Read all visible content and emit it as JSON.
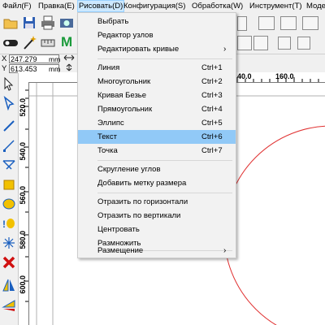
{
  "menubar": {
    "items": [
      {
        "label": "Файл(F)"
      },
      {
        "label": "Правка(E)"
      },
      {
        "label": "Рисовать(D)"
      },
      {
        "label": "Конфигурация(S)"
      },
      {
        "label": "Обработка(W)"
      },
      {
        "label": "Инструмент(T)"
      },
      {
        "label": "Моде"
      }
    ]
  },
  "coords": {
    "x_label": "X",
    "x_value": "247.279",
    "x_unit": "mm",
    "y_label": "Y",
    "y_value": "613.453",
    "y_unit": "mm"
  },
  "toolbar": {
    "m_label": "M"
  },
  "ruler": {
    "h_labels": [
      "40.0",
      "160.0"
    ],
    "v_labels": [
      "520.0",
      "540.0",
      "560.0",
      "580.0",
      "600.0"
    ]
  },
  "draw_menu": {
    "items": [
      {
        "label": "Выбрать",
        "shortcut": ""
      },
      {
        "label": "Редактор узлов",
        "shortcut": ""
      },
      {
        "label": "Редактировать кривые",
        "shortcut": "",
        "submenu": true
      },
      {
        "label": "Линия",
        "shortcut": "Ctrl+1"
      },
      {
        "label": "Многоугольник",
        "shortcut": "Ctrl+2"
      },
      {
        "label": "Кривая Безье",
        "shortcut": "Ctrl+3"
      },
      {
        "label": "Прямоугольник",
        "shortcut": "Ctrl+4"
      },
      {
        "label": "Эллипс",
        "shortcut": "Ctrl+5"
      },
      {
        "label": "Текст",
        "shortcut": "Ctrl+6",
        "highlighted": true
      },
      {
        "label": "Точка",
        "shortcut": "Ctrl+7"
      },
      {
        "label": "Скругление углов",
        "shortcut": ""
      },
      {
        "label": "Добавить метку размера",
        "shortcut": ""
      },
      {
        "label": "Отразить по горизонтали",
        "shortcut": ""
      },
      {
        "label": "Отразить по вертикали",
        "shortcut": ""
      },
      {
        "label": "Центровать",
        "shortcut": ""
      },
      {
        "label": "Размножить",
        "shortcut": ""
      },
      {
        "label": "Размещение",
        "shortcut": "",
        "submenu": true
      }
    ],
    "submenu_arrow": "›"
  },
  "colors": {
    "menu_highlight": "#91c9f7",
    "active_menubar": "#cce8ff",
    "circle_stroke": "#e03030",
    "toolbar_green": "#1a9a3a"
  },
  "icons": [
    "folder-icon",
    "save-icon",
    "print-icon",
    "camera-icon",
    "wand-icon",
    "toggle-icon",
    "arrow-icon"
  ]
}
